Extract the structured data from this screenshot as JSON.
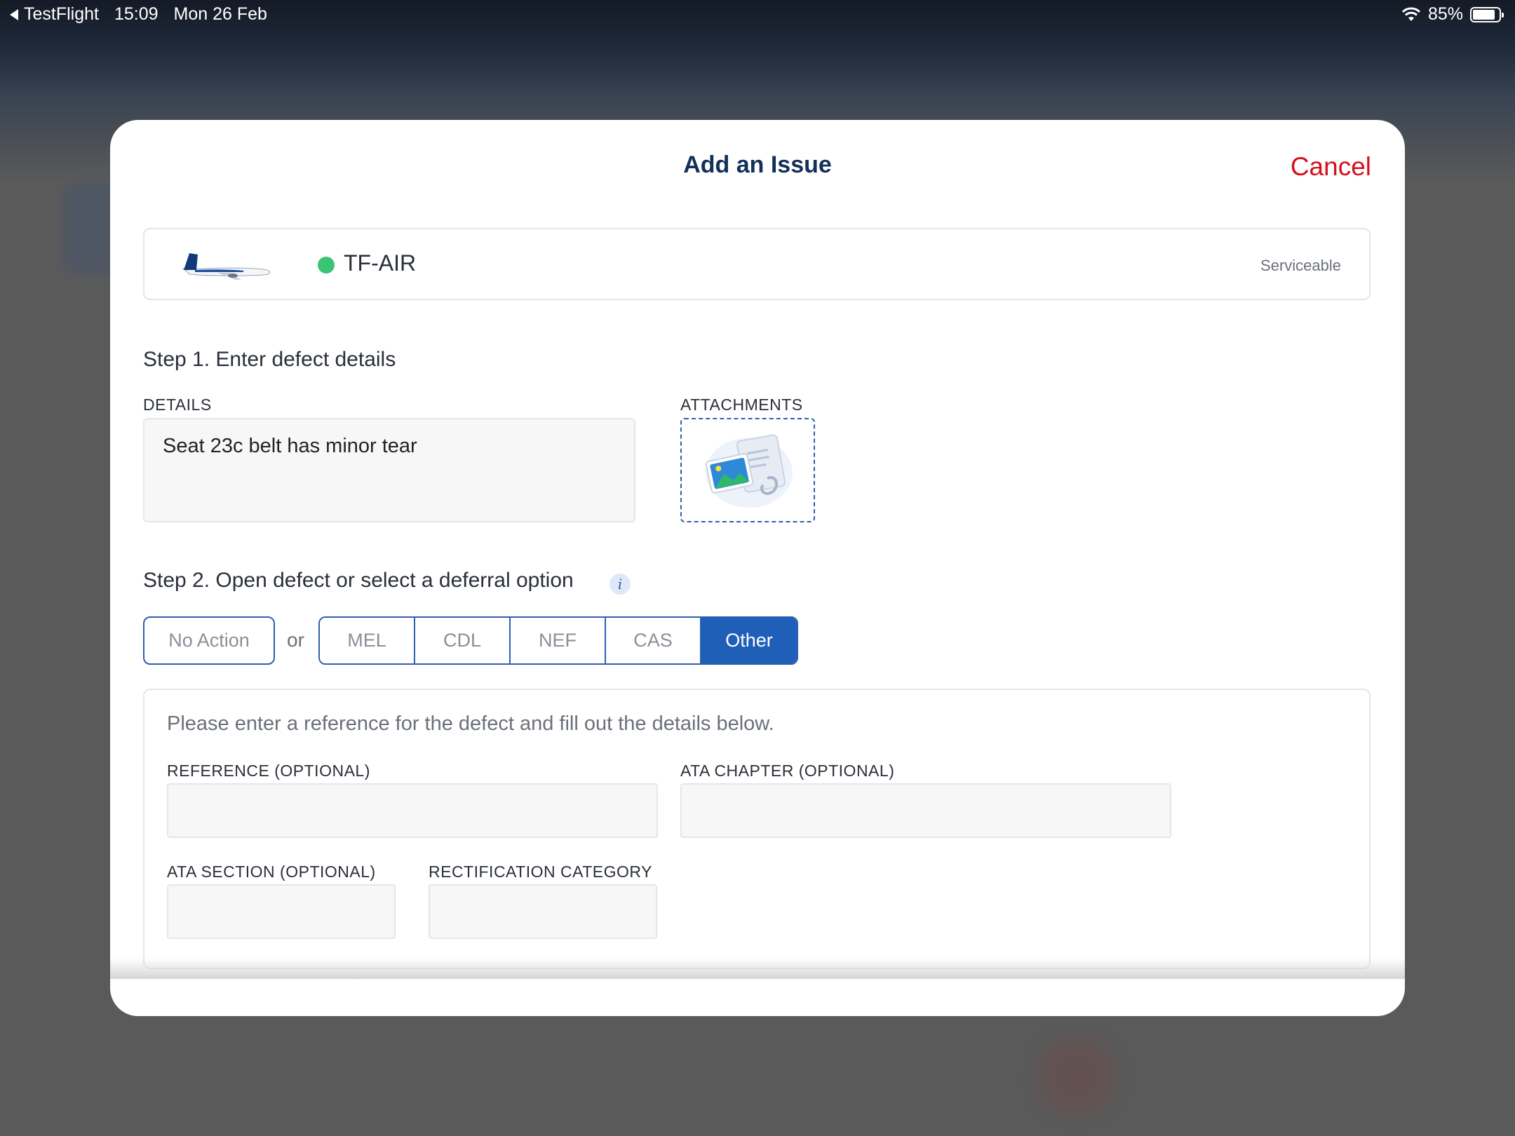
{
  "status_bar": {
    "back_app": "TestFlight",
    "time": "15:09",
    "date": "Mon 26 Feb",
    "battery": "85%",
    "battery_level": 0.85
  },
  "modal": {
    "title": "Add an Issue",
    "cancel_label": "Cancel"
  },
  "aircraft": {
    "registration": "TF-AIR",
    "status": "Serviceable",
    "status_color": "#3ac474"
  },
  "step1": {
    "heading": "Step 1. Enter defect details",
    "details_label": "DETAILS",
    "details_value": "Seat 23c belt has minor tear",
    "attachments_label": "ATTACHMENTS"
  },
  "step2": {
    "heading": "Step 2. Open defect or select a deferral option",
    "no_action_label": "No Action",
    "or_label": "or",
    "options": [
      "MEL",
      "CDL",
      "NEF",
      "CAS",
      "Other"
    ],
    "selected": "Other"
  },
  "other_panel": {
    "hint": "Please enter a reference for the defect and fill out the details below.",
    "reference_label": "REFERENCE (OPTIONAL)",
    "reference_value": "",
    "ata_chapter_label": "ATA CHAPTER (OPTIONAL)",
    "ata_chapter_value": "",
    "ata_section_label": "ATA SECTION (OPTIONAL)",
    "ata_section_value": "",
    "rectification_label": "RECTIFICATION CATEGORY",
    "rectification_value": ""
  },
  "colors": {
    "accent": "#1f5fb8",
    "cancel": "#d4101c",
    "title": "#13305a"
  }
}
